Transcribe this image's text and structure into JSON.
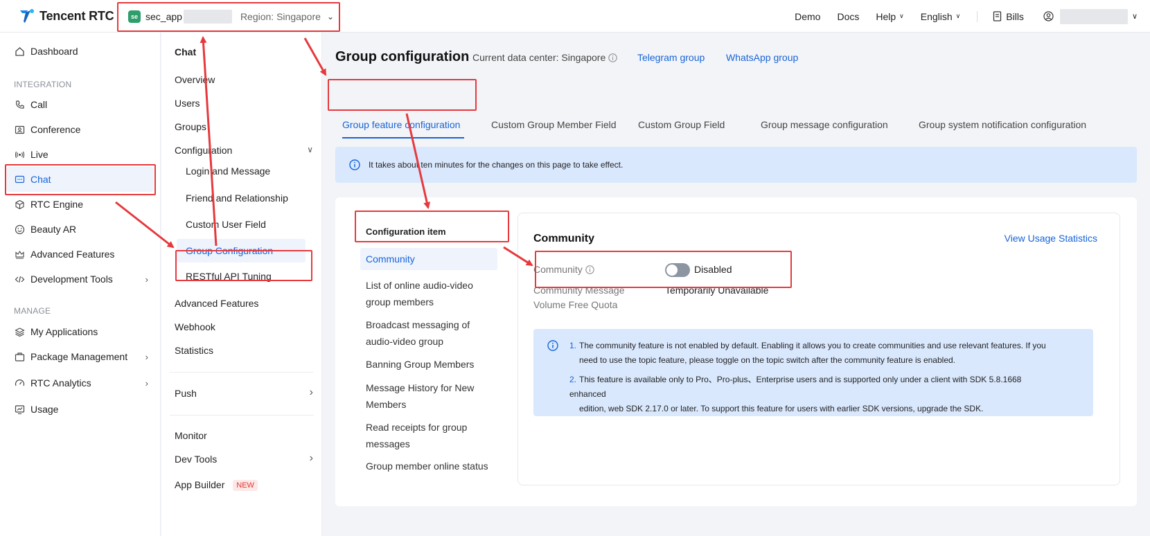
{
  "header": {
    "brand": "Tencent RTC",
    "app_badge": "se",
    "app_name": "sec_app",
    "region": "Region: Singapore",
    "nav": [
      "Demo",
      "Docs",
      "Help",
      "English"
    ],
    "bills": "Bills"
  },
  "sidebar": {
    "dashboard": "Dashboard",
    "integration_label": "INTEGRATION",
    "integration": [
      "Call",
      "Conference",
      "Live",
      "Chat",
      "RTC Engine",
      "Beauty AR",
      "Advanced Features",
      "Development Tools"
    ],
    "manage_label": "MANAGE",
    "manage": [
      "My Applications",
      "Package Management",
      "RTC Analytics",
      "Usage"
    ]
  },
  "subnav": {
    "title": "Chat",
    "items": [
      "Overview",
      "Users",
      "Groups",
      "Configuration"
    ],
    "config_children": [
      "Login and Message",
      "Friend and Relationship",
      "Custom User Field",
      "Group Configuration",
      "RESTful API Tuning"
    ],
    "after": [
      "Advanced Features",
      "Webhook",
      "Statistics"
    ],
    "push": "Push",
    "monitor": "Monitor",
    "dev_tools": "Dev Tools",
    "app_builder": "App Builder",
    "new_tag": "NEW"
  },
  "main": {
    "title": "Group configuration",
    "data_center": "Current data center: Singapore",
    "telegram": "Telegram group",
    "whatsapp": "WhatsApp group",
    "tabs": [
      "Group feature configuration",
      "Custom Group Member Field",
      "Custom Group Field",
      "Group message configuration",
      "Group system notification configuration"
    ],
    "notice": "It takes about ten minutes for the changes on this page to take effect."
  },
  "config": {
    "heading": "Configuration item",
    "items": [
      [
        "Community"
      ],
      [
        "List of online audio-video",
        "group members"
      ],
      [
        "Broadcast messaging of",
        "audio-video group"
      ],
      [
        "Banning Group Members"
      ],
      [
        "Message History for New",
        "Members"
      ],
      [
        "Read receipts for group",
        "messages"
      ],
      [
        "Group member online status"
      ]
    ]
  },
  "panel": {
    "title": "Community",
    "usage_link": "View Usage Statistics",
    "community_label": "Community",
    "toggle_state": "Disabled",
    "quota_label_1": "Community Message",
    "quota_label_2": "Volume Free Quota",
    "quota_value": "Temporarily Unavailable",
    "tip1_num": "1.",
    "tip1_a": "The community feature is not enabled by default. Enabling it allows you to create communities and use relevant features. If you",
    "tip1_b": "need to use the topic feature, please toggle on the topic switch after the community feature is enabled.",
    "tip2_num": "2.",
    "tip2_a": "This feature is available only to Pro、Pro-plus、Enterprise users and is supported only under a client with SDK 5.8.1668 enhanced",
    "tip2_b": "edition, web SDK 2.17.0 or later. To support this feature for users with earlier SDK versions, upgrade the SDK."
  },
  "colors": {
    "accent": "#1664d9",
    "annotation": "#e5393d",
    "notice_bg": "#d9e8fd"
  }
}
